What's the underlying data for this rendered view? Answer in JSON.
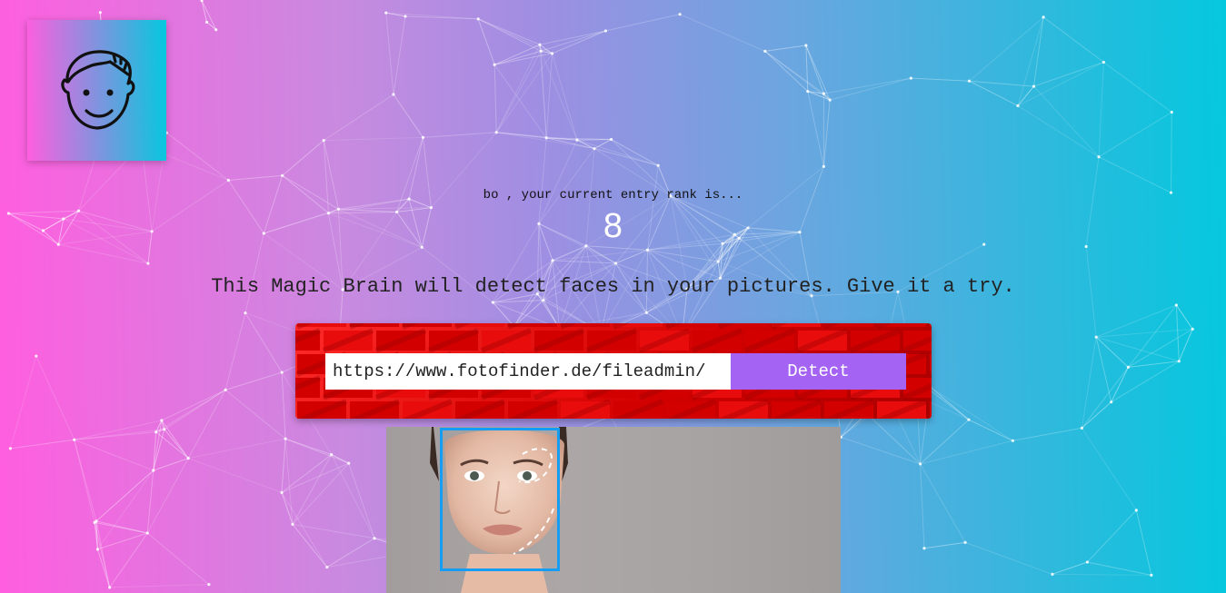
{
  "rank": {
    "caption": "bo , your current entry rank is...",
    "value": "8"
  },
  "intro": {
    "text": "This Magic Brain will detect faces in your pictures. Give it a try."
  },
  "form": {
    "url_value": "https://www.fotofinder.de/fileadmin/",
    "detect_label": "Detect"
  },
  "icons": {
    "logo": "brain-face-icon"
  },
  "colors": {
    "gradient_start": "#ff5edf",
    "gradient_end": "#04c8de",
    "button": "#a463f2",
    "face_box": "#149df2",
    "brick": "#d20000"
  }
}
